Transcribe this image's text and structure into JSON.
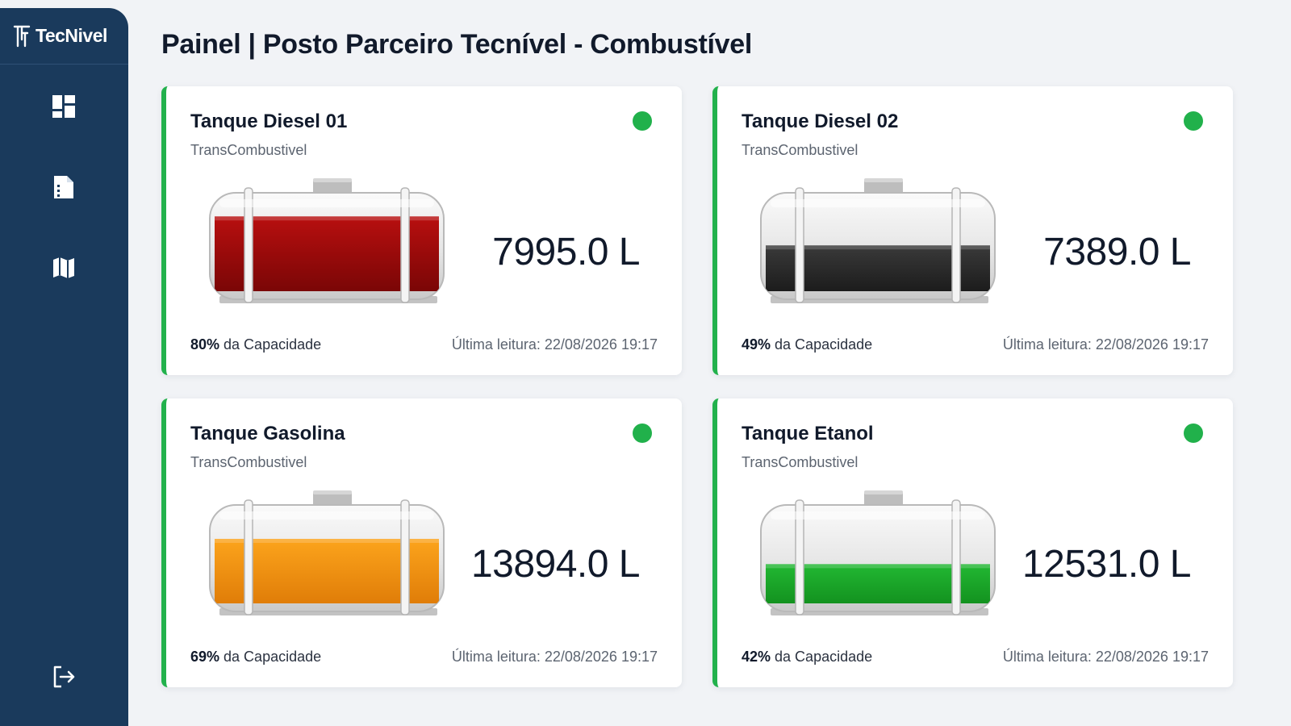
{
  "app": {
    "logo_text": "TecNivel",
    "page_title": "Painel | Posto Parceiro Tecnível - Combustível"
  },
  "sidebar": {
    "items": [
      {
        "icon": "dashboard-icon"
      },
      {
        "icon": "document-icon"
      },
      {
        "icon": "map-icon"
      }
    ],
    "logout_icon": "logout-icon"
  },
  "tanks": [
    {
      "name": "Tanque Diesel 01",
      "supplier": "TransCombustivel",
      "volume": "7995.0 L",
      "capacity_pct": "80%",
      "capacity_suffix": " da Capacidade",
      "fill_fraction": 0.8,
      "fill_color": "#b80f0f",
      "fill_color_dark": "#7a0606",
      "last_read": "Última leitura: 22/08/2026 19:17",
      "status_color": "#21b14b"
    },
    {
      "name": "Tanque Diesel 02",
      "supplier": "TransCombustivel",
      "volume": "7389.0 L",
      "capacity_pct": "49%",
      "capacity_suffix": " da Capacidade",
      "fill_fraction": 0.49,
      "fill_color": "#3a3a3a",
      "fill_color_dark": "#1c1c1c",
      "last_read": "Última leitura: 22/08/2026 19:17",
      "status_color": "#21b14b"
    },
    {
      "name": "Tanque Gasolina",
      "supplier": "TransCombustivel",
      "volume": "13894.0 L",
      "capacity_pct": "69%",
      "capacity_suffix": " da Capacidade",
      "fill_fraction": 0.69,
      "fill_color": "#fca41c",
      "fill_color_dark": "#e07d08",
      "last_read": "Última leitura: 22/08/2026 19:17",
      "status_color": "#21b14b"
    },
    {
      "name": "Tanque Etanol",
      "supplier": "TransCombustivel",
      "volume": "12531.0 L",
      "capacity_pct": "42%",
      "capacity_suffix": " da Capacidade",
      "fill_fraction": 0.42,
      "fill_color": "#22b833",
      "fill_color_dark": "#13921f",
      "last_read": "Última leitura: 22/08/2026 19:17",
      "status_color": "#21b14b"
    }
  ],
  "colors": {
    "sidebar": "#1a3a5c",
    "accent": "#22b14c",
    "background": "#f1f3f6"
  }
}
